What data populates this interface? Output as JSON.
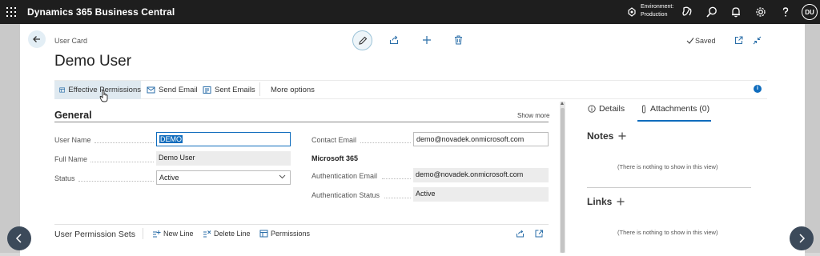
{
  "app": {
    "name": "Dynamics 365 Business Central"
  },
  "environment": {
    "line1": "Environment:",
    "line2": "Production"
  },
  "user": {
    "initials": "DU"
  },
  "header": {
    "breadcrumb": "User Card",
    "title": "Demo User",
    "saved": "Saved"
  },
  "actions": {
    "effective_permissions": "Effective Permissions",
    "send_email": "Send Email",
    "sent_emails": "Sent Emails",
    "more_options": "More options"
  },
  "general": {
    "title": "General",
    "show_more": "Show more",
    "user_name": {
      "label": "User Name",
      "value": "DEMO"
    },
    "full_name": {
      "label": "Full Name",
      "value": "Demo User"
    },
    "status": {
      "label": "Status",
      "value": "Active"
    },
    "contact_email": {
      "label": "Contact Email",
      "value": "demo@novadek.onmicrosoft.com"
    },
    "ms365": {
      "heading": "Microsoft 365"
    },
    "auth_email": {
      "label": "Authentication Email",
      "value": "demo@novadek.onmicrosoft.com"
    },
    "auth_status": {
      "label": "Authentication Status",
      "value": "Active"
    }
  },
  "permission_sets": {
    "title": "User Permission Sets",
    "new_line": "New Line",
    "delete_line": "Delete Line",
    "permissions": "Permissions"
  },
  "factbox": {
    "tab_details": "Details",
    "tab_attachments": "Attachments (0)",
    "notes_title": "Notes",
    "notes_empty": "(There is nothing to show in this view)",
    "links_title": "Links",
    "links_empty": "(There is nothing to show in this view)"
  },
  "colors": {
    "topbar": "#1e1e1e",
    "accent": "#0f6cbd",
    "nav_button": "#3c4a5a"
  }
}
